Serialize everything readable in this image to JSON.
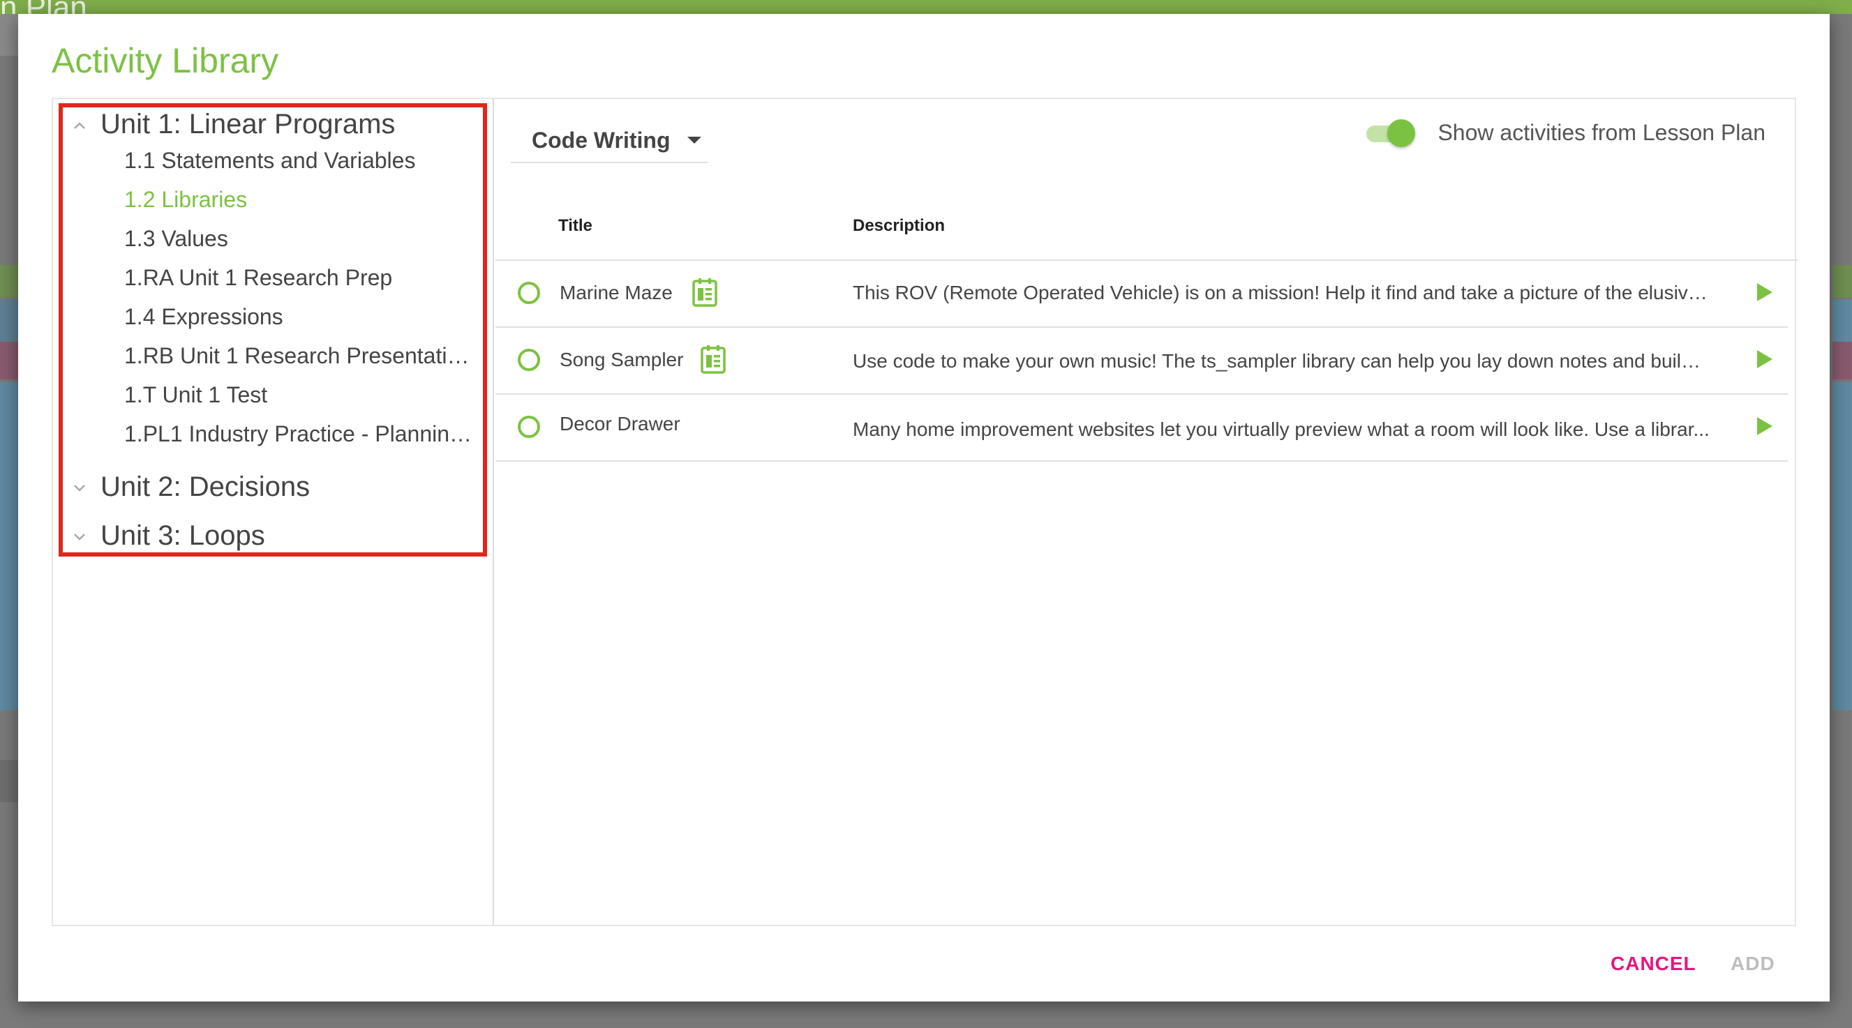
{
  "background": {
    "title_fragment": "n Plan",
    "colors": {
      "topbar": "#7fae4b",
      "pink_row": "#d77ba1",
      "blue_row": "#79b6d6"
    }
  },
  "dialog": {
    "title": "Activity Library",
    "tree": {
      "units": [
        {
          "label": "Unit 1: Linear Programs",
          "expanded": true,
          "icon": "chevron-up-icon",
          "lessons": [
            {
              "label": "1.1 Statements and Variables",
              "active": false
            },
            {
              "label": "1.2 Libraries",
              "active": true
            },
            {
              "label": "1.3 Values",
              "active": false
            },
            {
              "label": "1.RA Unit 1 Research Prep",
              "active": false
            },
            {
              "label": "1.4 Expressions",
              "active": false
            },
            {
              "label": "1.RB Unit 1 Research Presentatio…",
              "active": false
            },
            {
              "label": "1.T Unit 1 Test",
              "active": false
            },
            {
              "label": "1.PL1 Industry Practice - Plannin…",
              "active": false
            }
          ]
        },
        {
          "label": "Unit 2: Decisions",
          "expanded": false,
          "icon": "chevron-down-icon"
        },
        {
          "label": "Unit 3: Loops",
          "expanded": false,
          "icon": "chevron-down-icon"
        }
      ]
    },
    "filter": {
      "selected": "Code Writing"
    },
    "toggle": {
      "label": "Show activities from Lesson Plan",
      "on": true
    },
    "table": {
      "headers": {
        "title": "Title",
        "description": "Description"
      },
      "rows": [
        {
          "title": "Marine Maze",
          "has_doc_icon": true,
          "description": "This ROV (Remote Operated Vehicle) is on a mission! Help it find and take a picture of the elusive ..."
        },
        {
          "title": "Song Sampler",
          "has_doc_icon": true,
          "description": "Use code to make your own music! The ts_sampler library can help you lay down notes and build a..."
        },
        {
          "title": "Decor Drawer",
          "has_doc_icon": false,
          "description": "Many home improvement websites let you virtually preview what a room will look like. Use a librar..."
        }
      ]
    },
    "actions": {
      "cancel": "CANCEL",
      "add": "ADD"
    },
    "colors": {
      "accent": "#7cc242",
      "cancel": "#e5147f",
      "disabled": "#bdbdbd",
      "highlight_border": "#e1261c"
    }
  }
}
